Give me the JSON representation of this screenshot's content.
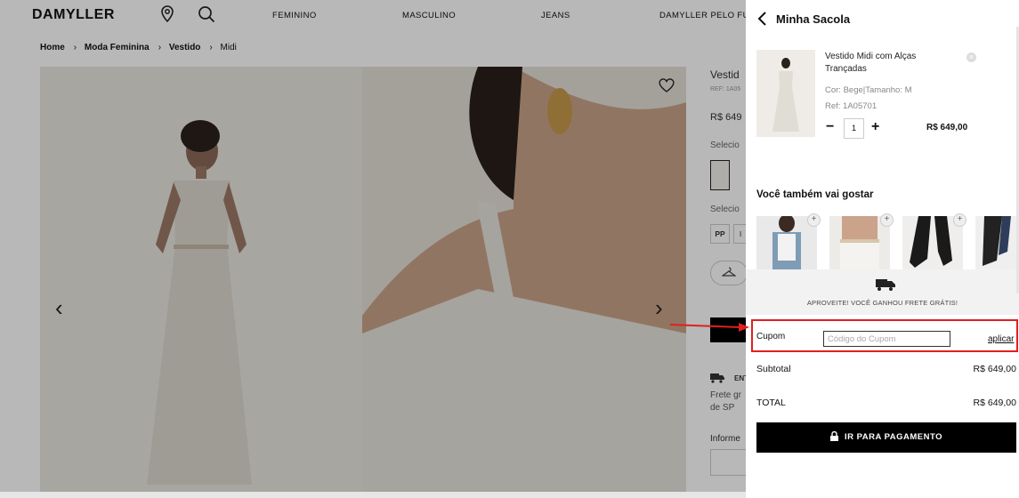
{
  "header": {
    "logo": "DAMYLLER",
    "nav": [
      "FEMININO",
      "MASCULINO",
      "JEANS",
      "DAMYLLER PELO FUTU"
    ]
  },
  "breadcrumb": [
    "Home",
    "Moda Feminina",
    "Vestido",
    "Midi"
  ],
  "product_side": {
    "title_partial": "Vestid",
    "ref_partial": "REF: 1A05",
    "price_partial": "R$ 649",
    "select_color_partial": "Selecio",
    "select_size_partial": "Selecio",
    "size_pp": "PP",
    "size_next_partial": "I",
    "shipping_partial": "ENT",
    "shipping_note": "Frete gr",
    "shipping_note2": "de SP",
    "inform_partial": "Informe"
  },
  "cart": {
    "title": "Minha Sacola",
    "item": {
      "name": "Vestido Midi com Alças Trançadas",
      "color_size": "Cor: Bege|Tamanho: M",
      "ref": "Ref: 1A05701",
      "qty": "1",
      "price": "R$ 649,00"
    },
    "reco_title": "Você também vai gostar",
    "shipping_message": "APROVEITE! VOCÊ GANHOU FRETE GRÁTIS!",
    "coupon_label": "Cupom",
    "coupon_placeholder": "Código do Cupom",
    "coupon_apply": "aplicar",
    "subtotal_label": "Subtotal",
    "subtotal_value": "R$ 649,00",
    "total_label": "TOTAL",
    "total_value": "R$ 649,00",
    "pay_button": "IR PARA PAGAMENTO"
  },
  "colors": {
    "accent_annotation": "#e0201f",
    "primary_button": "#000000"
  }
}
